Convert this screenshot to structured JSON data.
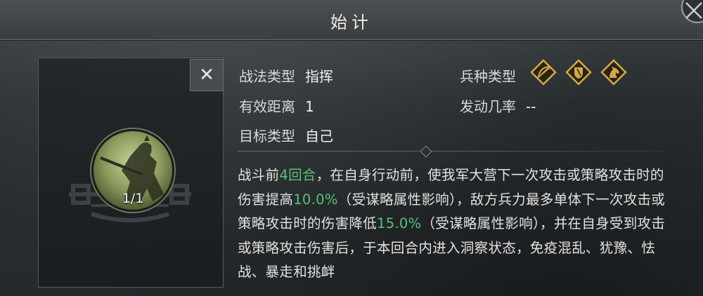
{
  "title": "始计",
  "close_label": "✕",
  "skill": {
    "count": "1/1",
    "fields": {
      "type_label": "战法类型",
      "type_value": "指挥",
      "range_label": "有效距离",
      "range_value": "1",
      "target_label": "目标类型",
      "target_value": "自己",
      "troop_label": "兵种类型",
      "rate_label": "发动几率",
      "rate_value": "--"
    },
    "troop_icons": [
      "bow-icon",
      "shield-icon",
      "horse-icon"
    ],
    "description": {
      "p1": "战斗前",
      "h1": "4回合",
      "p2": "，在自身行动前，使我军大营下一次攻击或策略攻击时的伤害提高",
      "h2": "10.0%",
      "p3": "（受谋略属性影响），敌方兵力最多单体下一次攻击或策略攻击时的伤害降低",
      "h3": "15.0%",
      "p4": "（受谋略属性影响），并在自身受到攻击或策略攻击伤害后，于本回合内进入洞察状态，免疫混乱、犹豫、怯战、暴走和挑衅"
    }
  },
  "colors": {
    "highlight": "#58c275",
    "gold": "#d4a947"
  }
}
